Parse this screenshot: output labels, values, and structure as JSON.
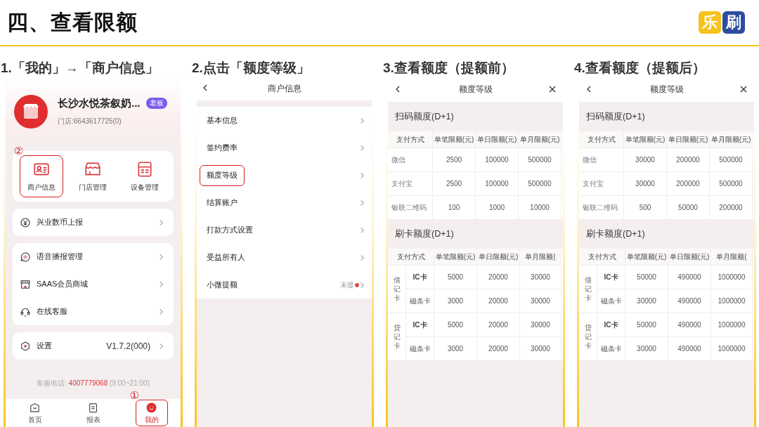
{
  "slide_title": "四、查看限额",
  "logo": [
    {
      "text": "乐",
      "color": "#f6c21c"
    },
    {
      "text": "刷",
      "color": "#2d4e9f"
    }
  ],
  "steps": [
    {
      "kind": "profile",
      "heading": "1.「我的」→「商户信息」",
      "store_name": "长沙水悦茶叙奶...",
      "role_badge": "老板",
      "store_id": "门店:6643617725(0)",
      "shortcuts": [
        {
          "label": "商户信息",
          "highlighted": true,
          "marker": "②"
        },
        {
          "label": "门店管理",
          "highlighted": false
        },
        {
          "label": "设备管理",
          "highlighted": false
        }
      ],
      "menu_groups": [
        {
          "items": [
            {
              "label": "兴业数币上报"
            }
          ]
        },
        {
          "items": [
            {
              "label": "语音播报管理"
            },
            {
              "label": "SAAS会员商城"
            },
            {
              "label": "在线客服"
            }
          ]
        },
        {
          "items": [
            {
              "label": "设置",
              "value": "V1.7.2(000)"
            }
          ]
        }
      ],
      "hotline": {
        "label": "客服电话:",
        "number": "4007779068",
        "hours": "(9:00~21:00)"
      },
      "tabs": [
        {
          "label": "首页",
          "selected": false,
          "highlighted": false
        },
        {
          "label": "报表",
          "selected": false,
          "highlighted": false
        },
        {
          "label": "我的",
          "selected": true,
          "highlighted": true,
          "marker": "①"
        }
      ]
    },
    {
      "kind": "menu",
      "heading": "2.点击「额度等级」",
      "screen_title": "商户信息",
      "items": [
        {
          "label": "基本信息",
          "highlighted": false
        },
        {
          "label": "签约费率",
          "highlighted": false
        },
        {
          "label": "额度等级",
          "highlighted": true
        },
        {
          "label": "结算账户",
          "highlighted": false
        },
        {
          "label": "打款方式设置",
          "highlighted": false
        },
        {
          "label": "受益所有人",
          "highlighted": false
        },
        {
          "label": "小微提额",
          "highlighted": false,
          "value": "未提",
          "dot": true
        }
      ]
    },
    {
      "kind": "limits",
      "heading": "3.查看额度（提额前）",
      "screen_title": "额度等级",
      "sections": [
        {
          "kind": "flat",
          "title": "扫码额度(D+1)",
          "columns": [
            "支付方式",
            "单笔限额(元)",
            "单日限额(元)",
            "单月限额(元)"
          ],
          "rows": [
            {
              "method": "微信",
              "values": [
                "2500",
                "100000",
                "500000"
              ]
            },
            {
              "method": "支付宝",
              "values": [
                "2500",
                "100000",
                "500000"
              ]
            },
            {
              "method": "银联二维码",
              "values": [
                "100",
                "1000",
                "10000"
              ]
            }
          ]
        },
        {
          "kind": "grouped",
          "title": "刷卡额度(D+1)",
          "columns": [
            "支付方式",
            "单笔限额(元)",
            "单日限额(元)",
            "单月限额("
          ],
          "groups": [
            {
              "name": "借记卡",
              "rows": [
                {
                  "type": "IC卡",
                  "values": [
                    "5000",
                    "20000",
                    "30000"
                  ]
                },
                {
                  "type": "磁条卡",
                  "values": [
                    "3000",
                    "20000",
                    "30000"
                  ]
                }
              ]
            },
            {
              "name": "贷记卡",
              "rows": [
                {
                  "type": "IC卡",
                  "values": [
                    "5000",
                    "20000",
                    "30000"
                  ]
                },
                {
                  "type": "磁条卡",
                  "values": [
                    "3000",
                    "20000",
                    "30000"
                  ]
                }
              ]
            }
          ]
        }
      ]
    },
    {
      "kind": "limits",
      "heading": "4.查看额度（提额后）",
      "screen_title": "额度等级",
      "sections": [
        {
          "kind": "flat",
          "title": "扫码额度(D+1)",
          "columns": [
            "支付方式",
            "单笔限额(元)",
            "单日限额(元)",
            "单月限额(元)"
          ],
          "rows": [
            {
              "method": "微信",
              "values": [
                "30000",
                "200000",
                "500000"
              ]
            },
            {
              "method": "支付宝",
              "values": [
                "30000",
                "200000",
                "500000"
              ]
            },
            {
              "method": "银联二维码",
              "values": [
                "500",
                "50000",
                "200000"
              ]
            }
          ]
        },
        {
          "kind": "grouped",
          "title": "刷卡额度(D+1)",
          "columns": [
            "支付方式",
            "单笔限额(元)",
            "单日限额(元)",
            "单月限额("
          ],
          "groups": [
            {
              "name": "借记卡",
              "rows": [
                {
                  "type": "IC卡",
                  "values": [
                    "50000",
                    "490000",
                    "1000000"
                  ]
                },
                {
                  "type": "磁条卡",
                  "values": [
                    "30000",
                    "490000",
                    "1000000"
                  ]
                }
              ]
            },
            {
              "name": "贷记卡",
              "rows": [
                {
                  "type": "IC卡",
                  "values": [
                    "50000",
                    "490000",
                    "1000000"
                  ]
                },
                {
                  "type": "磁条卡",
                  "values": [
                    "30000",
                    "490000",
                    "1000000"
                  ]
                }
              ]
            }
          ]
        }
      ]
    }
  ]
}
